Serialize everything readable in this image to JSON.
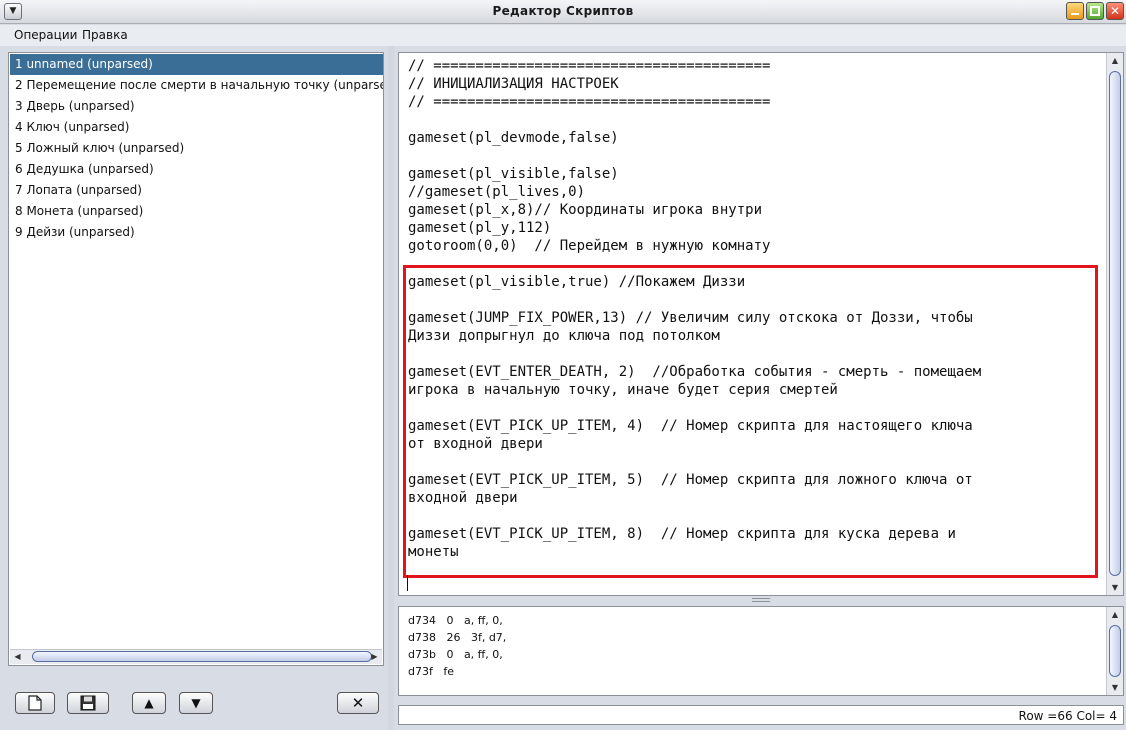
{
  "window": {
    "title": "Редактор Скриптов"
  },
  "menu": {
    "items": [
      "Операции",
      "Правка"
    ]
  },
  "scripts": [
    "1 unnamed  (unparsed)",
    "2 Перемещение после смерти в начальную точку  (unparsed)",
    "3 Дверь  (unparsed)",
    "4 Ключ  (unparsed)",
    "5 Ложный ключ  (unparsed)",
    "6 Дедушка  (unparsed)",
    "7 Лопата  (unparsed)",
    "8 Монета  (unparsed)",
    "9 Дейзи  (unparsed)"
  ],
  "selected_index": 0,
  "toolbar": {
    "delete_label": "✕"
  },
  "editor": {
    "lines": [
      "// ========================================",
      "// ИНИЦИАЛИЗАЦИЯ НАСТРОЕК",
      "// ========================================",
      "",
      "gameset(pl_devmode,false)",
      "",
      "gameset(pl_visible,false)",
      "//gameset(pl_lives,0)",
      "gameset(pl_x,8)// Координаты игрока внутри",
      "gameset(pl_y,112)",
      "gotoroom(0,0)  // Перейдем в нужную комнату",
      "",
      "gameset(pl_visible,true) //Покажем Диззи",
      "",
      "gameset(JUMP_FIX_POWER,13) // Увеличим силу отскока от Доззи, чтобы",
      "Диззи допрыгнул до ключа под потолком",
      "",
      "gameset(EVT_ENTER_DEATH, 2)  //Обработка события - смерть - помещаем",
      "игрока в начальную точку, иначе будет серия смертей",
      "",
      "gameset(EVT_PICK_UP_ITEM, 4)  // Номер скрипта для настоящего ключа",
      "от входной двери",
      "",
      "gameset(EVT_PICK_UP_ITEM, 5)  // Номер скрипта для ложного ключа от",
      "входной двери",
      "",
      "gameset(EVT_PICK_UP_ITEM, 8)  // Номер скрипта для куска дерева и",
      "монеты"
    ]
  },
  "bytecode": {
    "lines": [
      "d734   0   a, ff, 0,",
      "d738   26   3f, d7,",
      "d73b   0   a, ff, 0,",
      "d73f   fe"
    ]
  },
  "status": {
    "text": "Row =66 Col= 4"
  },
  "colors": {
    "selection": "#3a6e97",
    "highlight_border": "#e0161c"
  },
  "icons": {
    "system_menu": "chevron-down-icon",
    "new": "new-file-icon",
    "save": "floppy-disk-icon",
    "up": "arrow-up-icon",
    "down": "arrow-down-icon",
    "delete": "close-icon"
  }
}
